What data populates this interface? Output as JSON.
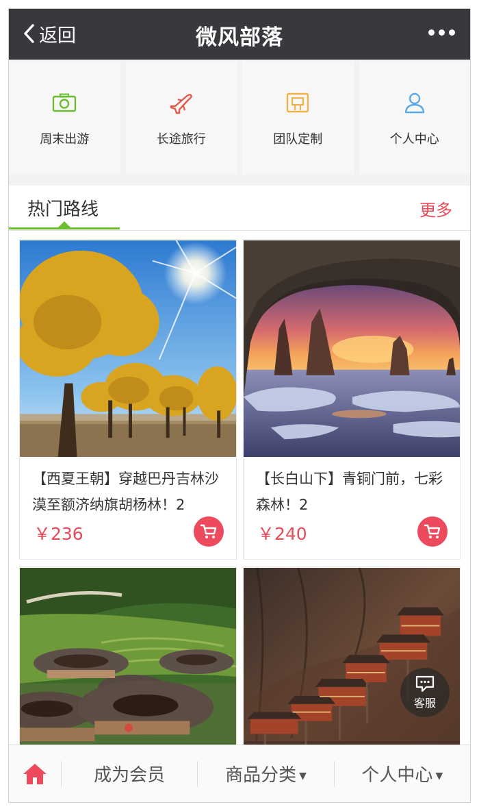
{
  "header": {
    "back_label": "返回",
    "title": "微风部落"
  },
  "categories": [
    {
      "label": "周末出游",
      "icon": "camera-icon",
      "color": "#6cbd2f"
    },
    {
      "label": "长途旅行",
      "icon": "airplane-icon",
      "color": "#e55a4e"
    },
    {
      "label": "团队定制",
      "icon": "ticket-icon",
      "color": "#f0b34a"
    },
    {
      "label": "个人中心",
      "icon": "user-icon",
      "color": "#5aa9e6"
    }
  ],
  "section": {
    "title": "热门路线",
    "more_label": "更多"
  },
  "products": [
    {
      "name": "【西夏王朝】穿越巴丹吉林沙漠至额济纳旗胡杨林！2",
      "price": "￥236",
      "image": "desert-poplar-forest"
    },
    {
      "name": "【长白山下】青铜门前，七彩森林！2",
      "price": "￥240",
      "image": "sea-cave-sunset"
    },
    {
      "name": "",
      "price": "",
      "image": "tulou-earth-buildings"
    },
    {
      "name": "",
      "price": "",
      "image": "hanging-temple-cliff"
    }
  ],
  "service": {
    "label": "客服"
  },
  "bottom_nav": {
    "member_label": "成为会员",
    "category_label": "商品分类",
    "profile_label": "个人中心"
  },
  "colors": {
    "header_bg": "#38393d",
    "accent_green": "#6cbd2f",
    "accent_red": "#e94a5a"
  }
}
